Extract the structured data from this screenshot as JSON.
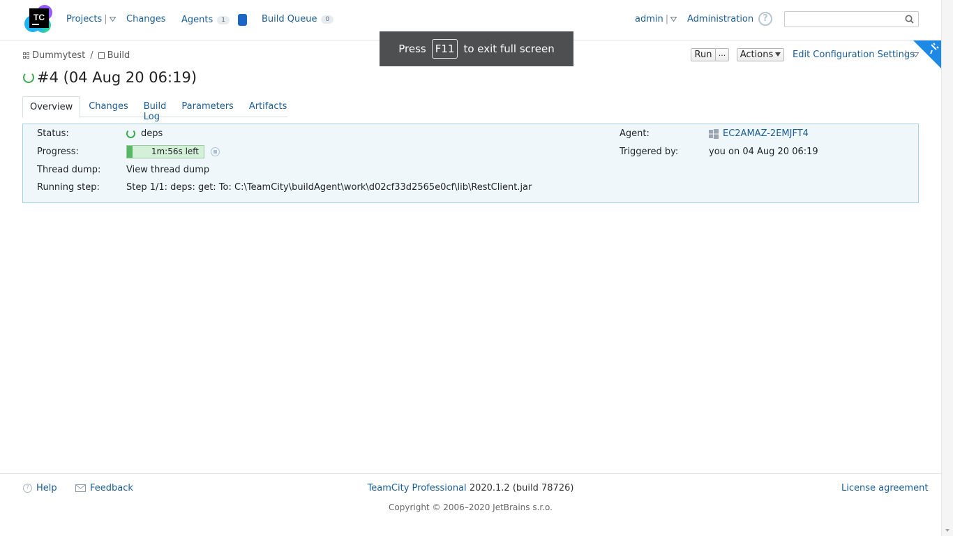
{
  "header": {
    "logo_text": "TC",
    "nav": {
      "projects": "Projects",
      "changes": "Changes",
      "agents": "Agents",
      "agents_count": "1",
      "build_queue": "Build Queue",
      "build_queue_count": "0"
    },
    "user": "admin",
    "administration": "Administration",
    "help_symbol": "?"
  },
  "fullscreen_banner": {
    "press": "Press",
    "key": "F11",
    "rest": "to exit full screen"
  },
  "breadcrumb": {
    "project": "Dummytest",
    "separator": "/",
    "build_config": "Build"
  },
  "toolbar": {
    "run": "Run",
    "more": "...",
    "actions": "Actions",
    "edit_settings": "Edit Configuration Settings"
  },
  "build": {
    "title": "#4 (04 Aug 20 06:19)"
  },
  "tabs": [
    {
      "label": "Overview",
      "active": true
    },
    {
      "label": "Changes",
      "active": false
    },
    {
      "label": "Build Log",
      "active": false
    },
    {
      "label": "Parameters",
      "active": false
    },
    {
      "label": "Artifacts",
      "active": false
    }
  ],
  "details": {
    "status_label": "Status:",
    "status_value": "deps",
    "progress_label": "Progress:",
    "progress_text": "1m:56s left",
    "progress_fraction": 0.07,
    "thread_dump_label": "Thread dump:",
    "thread_dump_link": "View thread dump",
    "running_step_label": "Running step:",
    "running_step_value": "Step 1/1: deps: get: To: C:\\TeamCity\\buildAgent\\work\\d02cf33d2565e0cf\\lib\\RestClient.jar",
    "agent_label": "Agent:",
    "agent_value": "EC2AMAZ-2EMJFT4",
    "triggered_label": "Triggered by:",
    "triggered_value": "you on 04 Aug 20 06:19"
  },
  "footer": {
    "help": "Help",
    "feedback": "Feedback",
    "product": "TeamCity Professional",
    "version": "2020.1.2 (build 78726)",
    "license": "License agreement",
    "copyright": "Copyright © 2006–2020 JetBrains s.r.o."
  },
  "colors": {
    "link": "#1a5d96",
    "panel_bg": "#f0f7fb",
    "panel_border": "#a8d3e6",
    "progress_green": "#57b863",
    "agent_square": "#1e66c6"
  },
  "icons": [
    "teamcity-logo",
    "search-icon",
    "help-icon",
    "grid-icon",
    "build-config-icon",
    "spinner-icon",
    "windows-icon",
    "stop-icon",
    "feedback-icon",
    "corner-ribbon-icon"
  ]
}
